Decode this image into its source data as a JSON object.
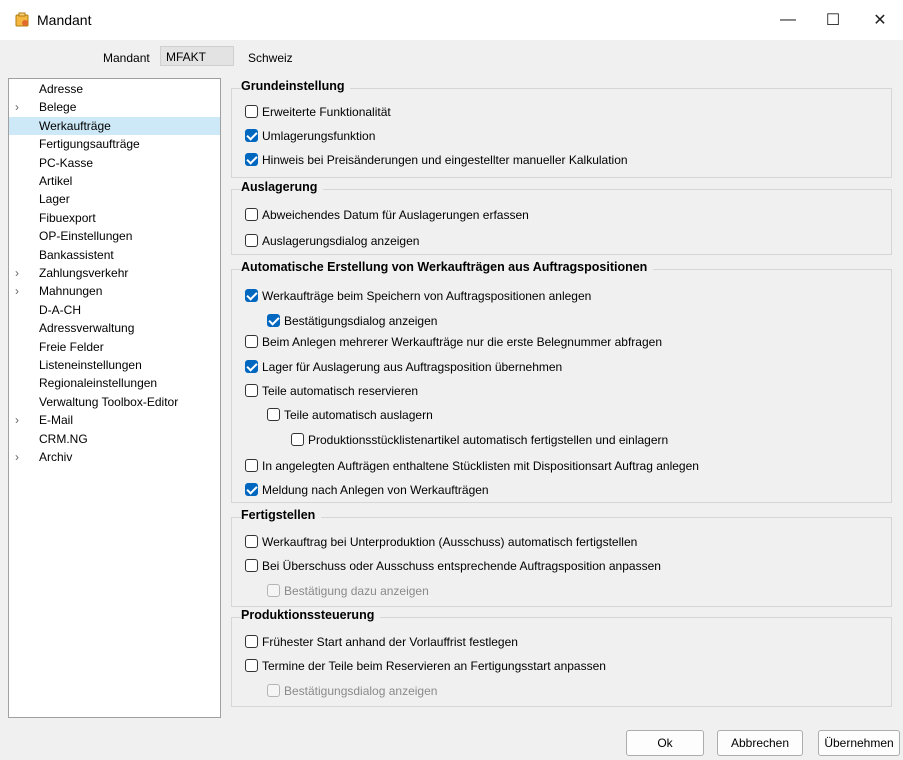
{
  "window": {
    "title": "Mandant",
    "minimize": "—",
    "maximize": "☐",
    "close": "✕"
  },
  "header": {
    "mandant_label": "Mandant",
    "mandant_code": "MFAKT",
    "mandant_name": "Schweiz"
  },
  "nav": {
    "items": [
      {
        "label": "Adresse",
        "expandable": false,
        "selected": false
      },
      {
        "label": "Belege",
        "expandable": true,
        "selected": false
      },
      {
        "label": "Werkaufträge",
        "expandable": false,
        "selected": true
      },
      {
        "label": "Fertigungsaufträge",
        "expandable": false,
        "selected": false
      },
      {
        "label": "PC-Kasse",
        "expandable": false,
        "selected": false
      },
      {
        "label": "Artikel",
        "expandable": false,
        "selected": false
      },
      {
        "label": "Lager",
        "expandable": false,
        "selected": false
      },
      {
        "label": "Fibuexport",
        "expandable": false,
        "selected": false
      },
      {
        "label": "OP-Einstellungen",
        "expandable": false,
        "selected": false
      },
      {
        "label": "Bankassistent",
        "expandable": false,
        "selected": false
      },
      {
        "label": "Zahlungsverkehr",
        "expandable": true,
        "selected": false
      },
      {
        "label": "Mahnungen",
        "expandable": true,
        "selected": false
      },
      {
        "label": "D-A-CH",
        "expandable": false,
        "selected": false
      },
      {
        "label": "Adressverwaltung",
        "expandable": false,
        "selected": false
      },
      {
        "label": "Freie Felder",
        "expandable": false,
        "selected": false
      },
      {
        "label": "Listeneinstellungen",
        "expandable": false,
        "selected": false
      },
      {
        "label": "Regionaleinstellungen",
        "expandable": false,
        "selected": false
      },
      {
        "label": "Verwaltung Toolbox-Editor",
        "expandable": false,
        "selected": false
      },
      {
        "label": "E-Mail",
        "expandable": true,
        "selected": false
      },
      {
        "label": "CRM.NG",
        "expandable": false,
        "selected": false
      },
      {
        "label": "Archiv",
        "expandable": true,
        "selected": false
      }
    ]
  },
  "groups": [
    {
      "title": "Grundeinstellung",
      "options": [
        {
          "label": "Erweiterte Funktionalität",
          "checked": false,
          "disabled": false
        },
        {
          "label": "Umlagerungsfunktion",
          "checked": true,
          "disabled": false
        },
        {
          "label": "Hinweis bei Preisänderungen und eingestellter manueller Kalkulation",
          "checked": true,
          "disabled": false
        }
      ]
    },
    {
      "title": "Auslagerung",
      "options": [
        {
          "label": "Abweichendes Datum für Auslagerungen erfassen",
          "checked": false,
          "disabled": false
        },
        {
          "label": "Auslagerungsdialog anzeigen",
          "checked": false,
          "disabled": false
        }
      ]
    },
    {
      "title": "Automatische Erstellung von Werkaufträgen aus Auftragspositionen",
      "options": [
        {
          "label": "Werkaufträge beim Speichern von Auftragspositionen anlegen",
          "checked": true,
          "disabled": false
        },
        {
          "label": "Bestätigungsdialog anzeigen",
          "checked": true,
          "disabled": false
        },
        {
          "label": "Beim Anlegen mehrerer Werkaufträge nur die erste Belegnummer abfragen",
          "checked": false,
          "disabled": false
        },
        {
          "label": "Lager für Auslagerung aus Auftragsposition übernehmen",
          "checked": true,
          "disabled": false
        },
        {
          "label": "Teile automatisch reservieren",
          "checked": false,
          "disabled": false
        },
        {
          "label": "Teile automatisch auslagern",
          "checked": false,
          "disabled": false
        },
        {
          "label": "Produktionsstücklistenartikel automatisch fertigstellen und einlagern",
          "checked": false,
          "disabled": false
        },
        {
          "label": "In angelegten Aufträgen enthaltene Stücklisten mit Dispositionsart Auftrag anlegen",
          "checked": false,
          "disabled": false
        },
        {
          "label": "Meldung nach Anlegen von Werkaufträgen",
          "checked": true,
          "disabled": false
        }
      ]
    },
    {
      "title": "Fertigstellen",
      "options": [
        {
          "label": "Werkauftrag bei Unterproduktion (Ausschuss) automatisch fertigstellen",
          "checked": false,
          "disabled": false
        },
        {
          "label": "Bei Überschuss oder Ausschuss entsprechende Auftragsposition anpassen",
          "checked": false,
          "disabled": false
        },
        {
          "label": "Bestätigung dazu anzeigen",
          "checked": false,
          "disabled": true
        }
      ]
    },
    {
      "title": "Produktionssteuerung",
      "options": [
        {
          "label": "Frühester Start anhand der Vorlauffrist festlegen",
          "checked": false,
          "disabled": false
        },
        {
          "label": "Termine der Teile beim Reservieren an Fertigungsstart anpassen",
          "checked": false,
          "disabled": false
        },
        {
          "label": "Bestätigungsdialog anzeigen",
          "checked": false,
          "disabled": true
        }
      ]
    }
  ],
  "buttons": {
    "ok": "Ok",
    "cancel": "Abbrechen",
    "apply": "Übernehmen"
  }
}
